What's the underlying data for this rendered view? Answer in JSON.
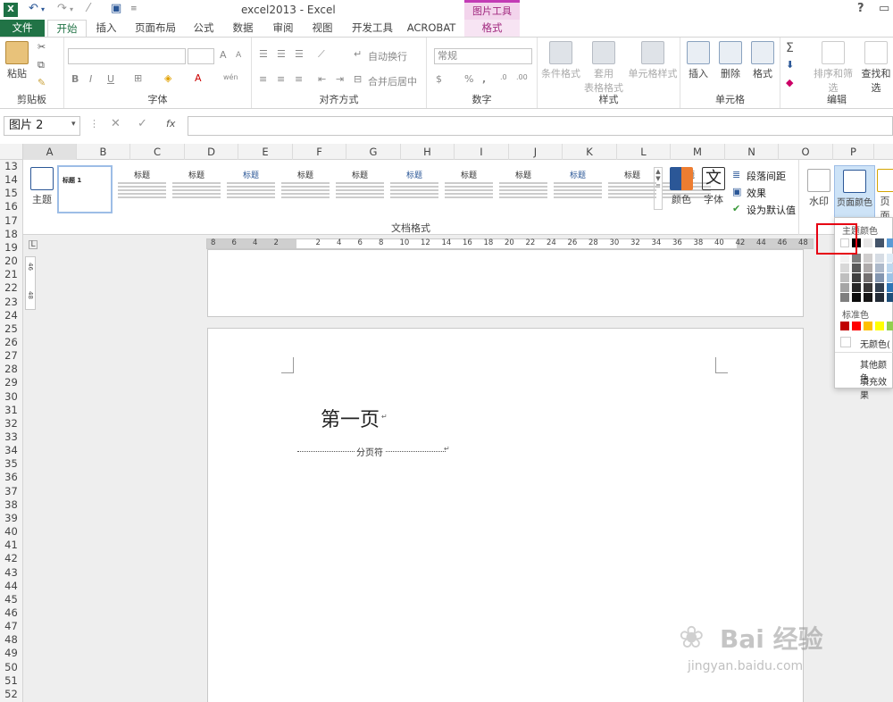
{
  "titlebar": {
    "title": "excel2013 - Excel",
    "context_tab_group": "图片工具",
    "help": "?"
  },
  "tabs": [
    "文件",
    "开始",
    "插入",
    "页面布局",
    "公式",
    "数据",
    "审阅",
    "视图",
    "开发工具",
    "ACROBAT",
    "格式"
  ],
  "ribbon": {
    "clipboard": {
      "label": "剪贴板",
      "paste": "粘贴"
    },
    "font": {
      "label": "字体",
      "bold": "B",
      "italic": "I",
      "underline": "U",
      "grow": "A",
      "shrink": "A",
      "wen": "wén"
    },
    "alignment": {
      "label": "对齐方式",
      "wrap": "自动换行",
      "merge": "合并后居中"
    },
    "number": {
      "label": "数字",
      "format": "常规",
      "percent": "%",
      "comma": ","
    },
    "styles": {
      "label": "样式",
      "conditional": "条件格式",
      "table": "套用",
      "table2": "表格格式",
      "cell_styles": "单元格样式"
    },
    "cells": {
      "label": "单元格",
      "insert": "插入",
      "delete": "删除",
      "format": "格式"
    },
    "editing": {
      "label": "编辑",
      "sort": "排序和筛选",
      "find": "查找和选"
    }
  },
  "formula_bar": {
    "name_box": "图片 2",
    "cancel": "✕",
    "enter": "✓",
    "fx": "fx"
  },
  "columns": [
    "A",
    "B",
    "C",
    "D",
    "E",
    "F",
    "G",
    "H",
    "I",
    "J",
    "K",
    "L",
    "M",
    "N",
    "O",
    "P"
  ],
  "rows": [
    "13",
    "14",
    "15",
    "16",
    "17",
    "18",
    "19",
    "20",
    "21",
    "22",
    "23",
    "24",
    "25",
    "26",
    "27",
    "28",
    "29",
    "30",
    "31",
    "32",
    "33",
    "34",
    "35",
    "36",
    "37",
    "38",
    "39",
    "40",
    "41",
    "42",
    "43",
    "44",
    "45",
    "46",
    "47",
    "48",
    "49",
    "50",
    "51",
    "52"
  ],
  "word": {
    "theme_btn": "主题",
    "doc_format_label": "文档格式",
    "style_samples": [
      "标题",
      "标题",
      "标题",
      "标题",
      "标题",
      "标题",
      "标题",
      "标题",
      "标题",
      "标题",
      "标题"
    ],
    "style_first": "标题 1",
    "colors_btn": "颜色",
    "fonts_btn": "字体",
    "font_glyph": "文",
    "para_spacing": "段落间距",
    "effects": "效果",
    "set_default": "设为默认值",
    "watermark_btn": "水印",
    "page_color_btn": "页面颜色",
    "page_border_btn": "页面",
    "ruler_numbers": [
      "8",
      "6",
      "4",
      "2",
      "",
      "2",
      "4",
      "6",
      "8",
      "10",
      "12",
      "14",
      "16",
      "18",
      "20",
      "22",
      "24",
      "26",
      "28",
      "30",
      "32",
      "34",
      "36",
      "38",
      "40",
      "42",
      "44",
      "46",
      "48"
    ],
    "vruler_marks": [
      "46",
      "48"
    ],
    "page_title": "第一页",
    "page_break": "分页符"
  },
  "page_color_menu": {
    "theme_colors": "主题颜色",
    "standard_colors": "标准色",
    "no_color": "无颜色(",
    "more_colors": "其他颜色",
    "fill_effects": "填充效果"
  },
  "colors": {
    "excel_green": "#217346",
    "accent_pink": "#c33bb5",
    "highlight_red": "#e60012"
  },
  "watermark": {
    "brand": "Bai 经验",
    "url": "jingyan.baidu.com"
  }
}
